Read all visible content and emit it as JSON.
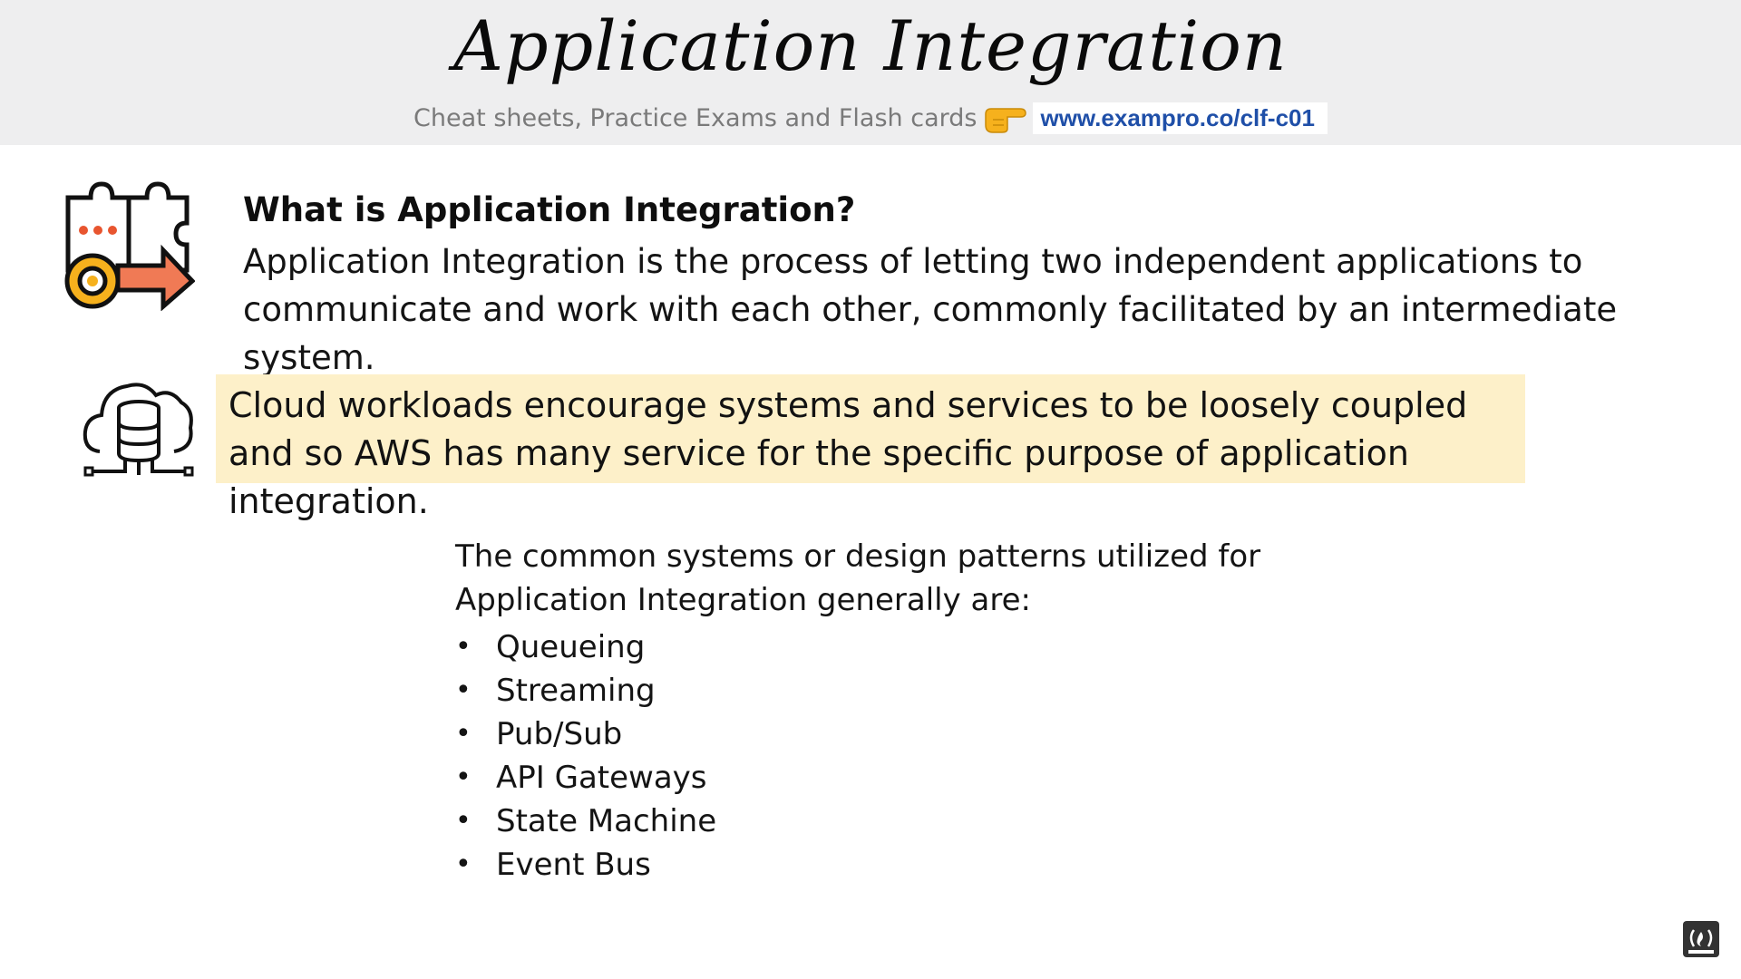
{
  "header": {
    "title": "Application Integration",
    "subtitle": "Cheat sheets, Practice Exams and Flash cards",
    "url": "www.exampro.co/clf-c01"
  },
  "section1": {
    "heading": "What is Application Integration?",
    "body": "Application Integration is the process of letting two independent applications to communicate and work with each other, commonly facilitated by an intermediate system."
  },
  "section2": {
    "highlight": "Cloud workloads encourage systems and services to be loosely coupled and so AWS has many service for the specific purpose of application integration."
  },
  "section3": {
    "intro": "The common systems or design patterns utilized for Application Integration generally are:",
    "items": [
      "Queueing",
      "Streaming",
      "Pub/Sub",
      "API Gateways",
      "State Machine",
      "Event Bus"
    ]
  },
  "icons": {
    "pointer": "hand-pointing-right-icon",
    "puzzle": "puzzle-gear-arrow-icon",
    "cloud": "cloud-database-icon",
    "corner": "freecodecamp-icon"
  },
  "colors": {
    "header_bg": "#eeeeef",
    "highlight_bg": "#fdf0c9",
    "link": "#1f4fa8",
    "accent_orange": "#f07a55",
    "accent_yellow": "#f6b11d"
  }
}
